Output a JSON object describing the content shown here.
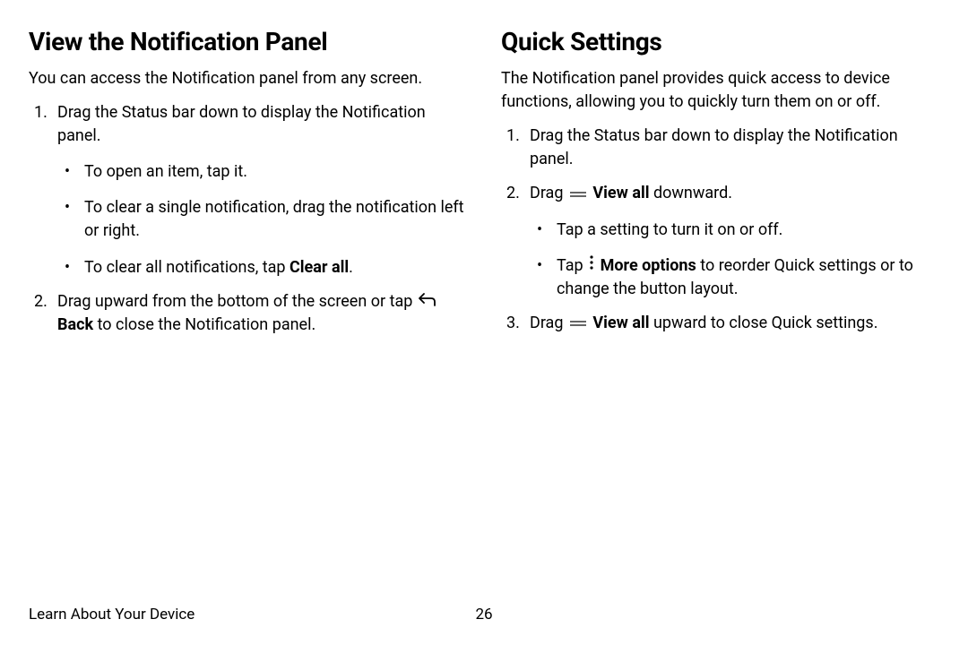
{
  "left": {
    "heading": "View the Notification Panel",
    "intro": "You can access the Notification panel from any screen.",
    "step1": "Drag the Status bar down to display the Notification panel.",
    "bullet1": "To open an item, tap it.",
    "bullet2": "To clear a single notification, drag the notification left or right.",
    "bullet3_pre": "To clear all notifications, tap ",
    "bullet3_bold": "Clear all",
    "bullet3_post": ".",
    "step2_pre": "Drag upward from the bottom of the screen or tap ",
    "step2_bold": " Back",
    "step2_post": " to close the Notification panel."
  },
  "right": {
    "heading": "Quick Settings",
    "intro": "The Notification panel provides quick access to device functions, allowing you to quickly turn them on or off.",
    "step1": "Drag the Status bar down to display the Notification panel.",
    "step2_pre": "Drag ",
    "step2_bold": " View all",
    "step2_post": " downward.",
    "bullet1": "Tap a setting to turn it on or off.",
    "bullet2_pre": "Tap ",
    "bullet2_bold": " More options",
    "bullet2_post": " to reorder Quick settings or to change the button layout.",
    "step3_pre": "Drag ",
    "step3_bold": " View all",
    "step3_post": " upward to close Quick settings."
  },
  "footer": {
    "section": "Learn About Your Device",
    "page": "26"
  }
}
